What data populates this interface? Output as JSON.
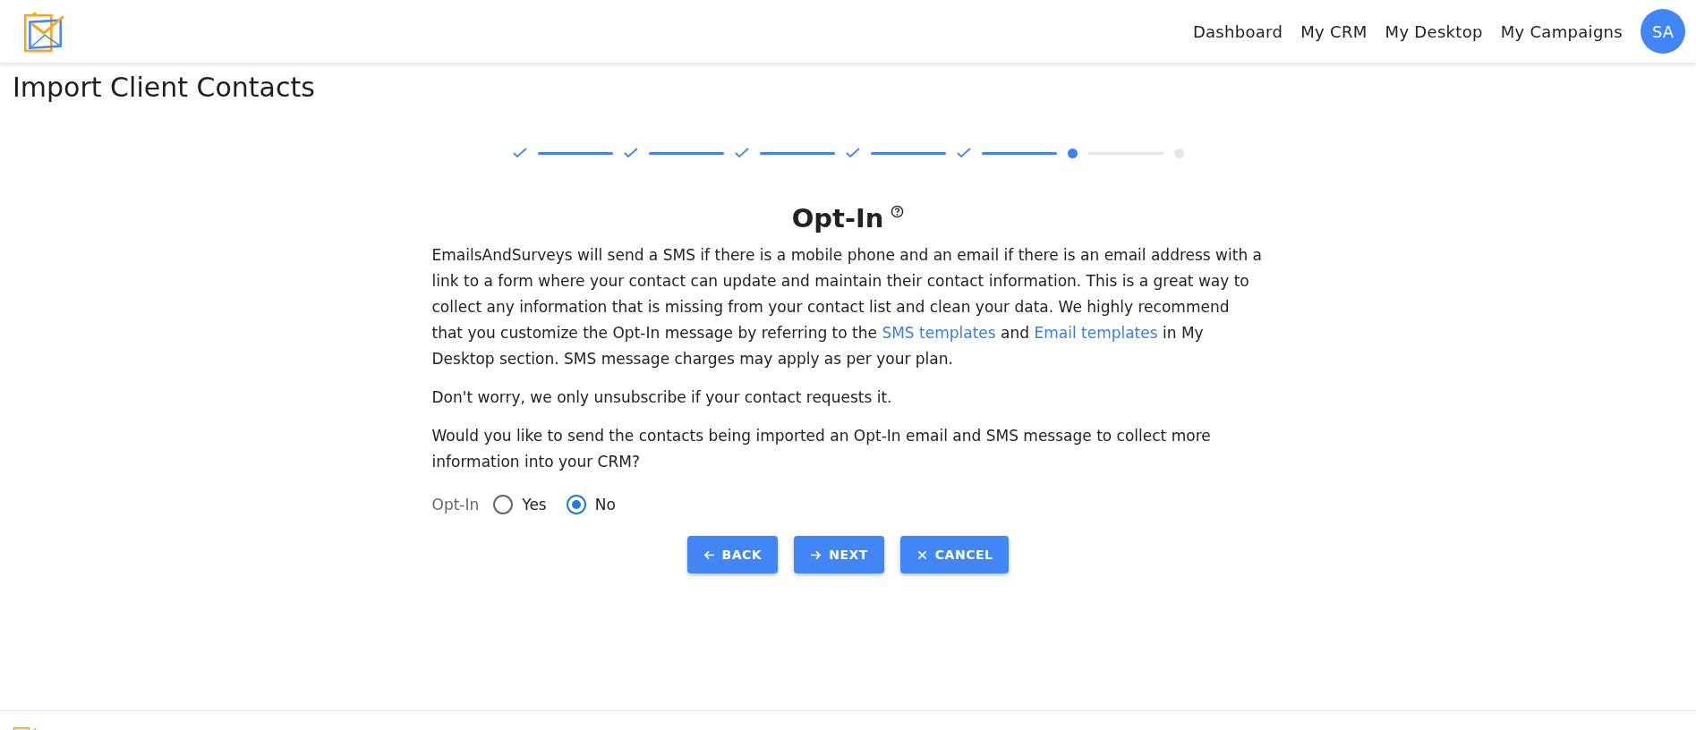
{
  "nav": {
    "links": [
      "Dashboard",
      "My CRM",
      "My Desktop",
      "My Campaigns"
    ],
    "avatar": "SA"
  },
  "page_title": "Import Client Contacts",
  "stepper": [
    {
      "kind": "done"
    },
    {
      "kind": "done"
    },
    {
      "kind": "done"
    },
    {
      "kind": "done"
    },
    {
      "kind": "done"
    },
    {
      "kind": "current"
    },
    {
      "kind": "pending"
    }
  ],
  "section": {
    "title": "Opt-In",
    "intro": [
      {
        "kind": "text",
        "text": "EmailsAndSurveys will send a SMS if there is a mobile phone and an email if there is an email address with a link to a form where your contact can update and maintain their contact information. This is a great way to collect any information that is missing from your contact list and clean your data. We highly recommend that you customize the Opt-In message by referring to the "
      },
      {
        "kind": "link",
        "text": "SMS templates"
      },
      {
        "kind": "text",
        "text": " and "
      },
      {
        "kind": "link",
        "text": "Email templates"
      },
      {
        "kind": "text",
        "text": " in My Desktop section. SMS message charges may apply as per your plan."
      }
    ],
    "paragraphs": [
      "Don't worry, we only unsubscribe if your contact requests it.",
      "Would you like to send the contacts being imported an Opt-In email and SMS message to collect more information into your CRM?"
    ],
    "radio_label": "Opt-In",
    "options": [
      {
        "label": "Yes",
        "selected": false
      },
      {
        "label": "No",
        "selected": true
      }
    ]
  },
  "buttons": [
    {
      "kind": "back",
      "label": "BACK"
    },
    {
      "kind": "next",
      "label": "NEXT"
    },
    {
      "kind": "cancel",
      "label": "CANCEL"
    }
  ]
}
